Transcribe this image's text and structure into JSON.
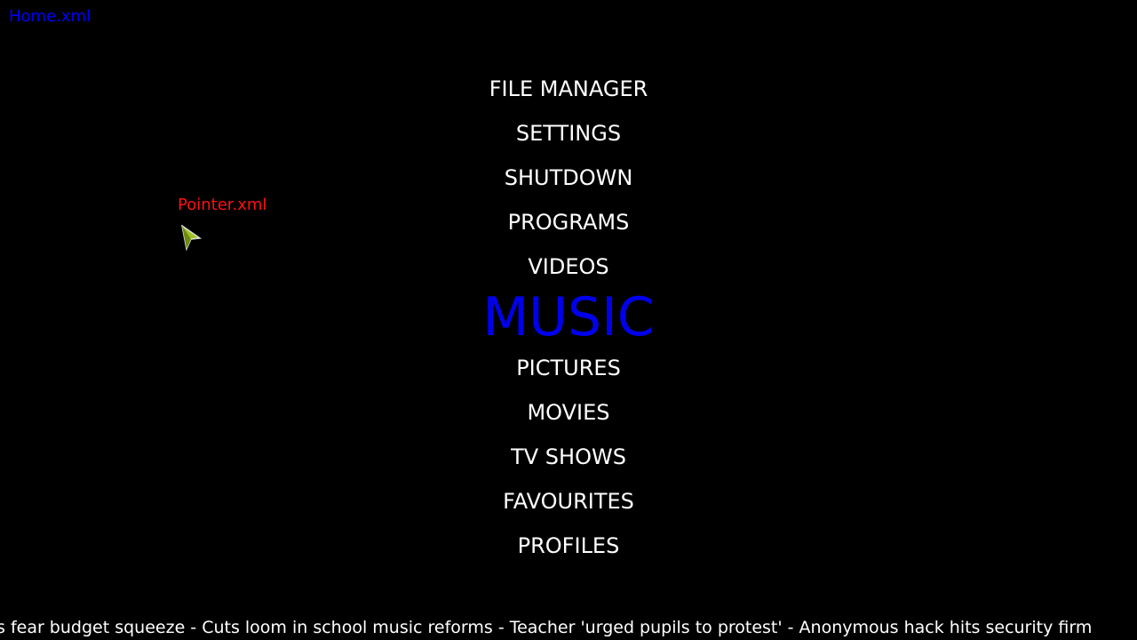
{
  "window_label": "Home.xml",
  "pointer": {
    "label": "Pointer.xml",
    "icon": "cursor-arrow-icon"
  },
  "menu": {
    "items": [
      "FILE MANAGER",
      "SETTINGS",
      "SHUTDOWN",
      "PROGRAMS",
      "VIDEOS",
      "MUSIC",
      "PICTURES",
      "MOVIES",
      "TV SHOWS",
      "FAVOURITES",
      "PROFILES"
    ],
    "selected": "MUSIC",
    "selected_color": "#0000ee"
  },
  "ticker": "s fear budget squeeze - Cuts loom in school music reforms - Teacher 'urged pupils to protest' - Anonymous hack hits security firm"
}
